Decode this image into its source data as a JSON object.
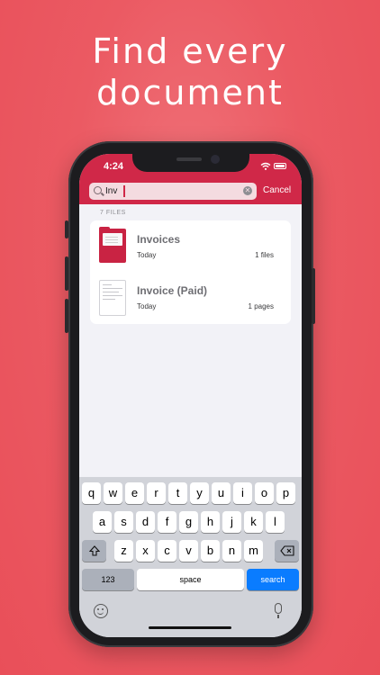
{
  "headline": {
    "line1": "Find every",
    "line2": "document"
  },
  "status_bar": {
    "time": "4:24"
  },
  "search": {
    "value": "Inv",
    "cancel_label": "Cancel"
  },
  "results": {
    "count_label": "7 FILES",
    "items": [
      {
        "title": "Invoices",
        "date": "Today",
        "count": "1 files",
        "kind": "folder"
      },
      {
        "title": "Invoice (Paid)",
        "date": "Today",
        "count": "1 pages",
        "kind": "document"
      }
    ]
  },
  "keyboard": {
    "row1": [
      "q",
      "w",
      "e",
      "r",
      "t",
      "y",
      "u",
      "i",
      "o",
      "p"
    ],
    "row2": [
      "a",
      "s",
      "d",
      "f",
      "g",
      "h",
      "j",
      "k",
      "l"
    ],
    "row3": [
      "z",
      "x",
      "c",
      "v",
      "b",
      "n",
      "m"
    ],
    "numbers_label": "123",
    "space_label": "space",
    "search_label": "search"
  },
  "colors": {
    "background": "#eb5a63",
    "topbar": "#d02848",
    "accent_blue": "#0a7cff"
  }
}
